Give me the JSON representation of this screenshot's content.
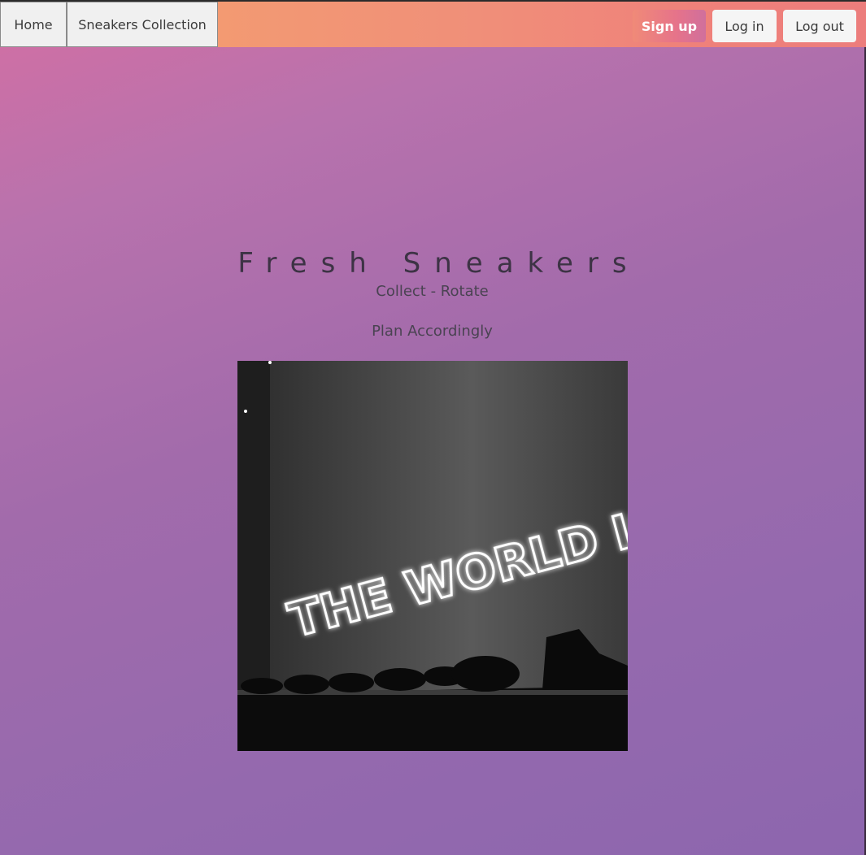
{
  "nav": {
    "home_label": "Home",
    "collection_label": "Sneakers Collection",
    "signup_label": "Sign up",
    "login_label": "Log in",
    "logout_label": "Log out"
  },
  "hero": {
    "title": "Fresh Sneakers",
    "subtitle": "Collect - Rotate",
    "tagline": "Plan Accordingly"
  },
  "photo": {
    "neon_text": "THE WORLD IS YOURS"
  },
  "colors": {
    "navbar_start": "#f3a06d",
    "navbar_end": "#ec7d7c",
    "background_top": "#d36fa3",
    "background_bottom": "#8d66ae",
    "signup_button": "#e6738a"
  }
}
